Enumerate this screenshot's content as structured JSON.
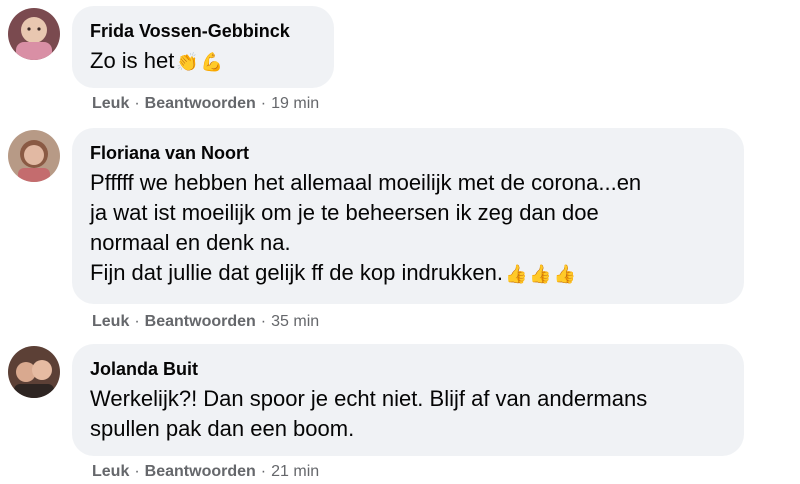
{
  "comments": [
    {
      "author": "Frida Vossen-Gebbinck",
      "text": "Zo is het",
      "emojis": [
        "👏",
        "💪"
      ],
      "actions": {
        "like": "Leuk",
        "reply": "Beantwoorden",
        "time": "19 min"
      }
    },
    {
      "author": "Floriana van Noort",
      "text": "Pfffff we hebben het allemaal moeilijk met de corona...en\nja wat ist moeilijk om je te beheersen ik zeg dan doe\nnormaal en denk na.\nFijn dat jullie dat gelijk ff de kop indrukken.",
      "emojis": [
        "👍",
        "👍",
        "👍"
      ],
      "actions": {
        "like": "Leuk",
        "reply": "Beantwoorden",
        "time": "35 min"
      }
    },
    {
      "author": "Jolanda Buit",
      "text": "Werkelijk?! Dan spoor je echt niet. Blijf af van andermans\nspullen pak dan een boom.",
      "emojis": [],
      "actions": {
        "like": "Leuk",
        "reply": "Beantwoorden",
        "time": "21 min"
      }
    }
  ],
  "separator": "·"
}
